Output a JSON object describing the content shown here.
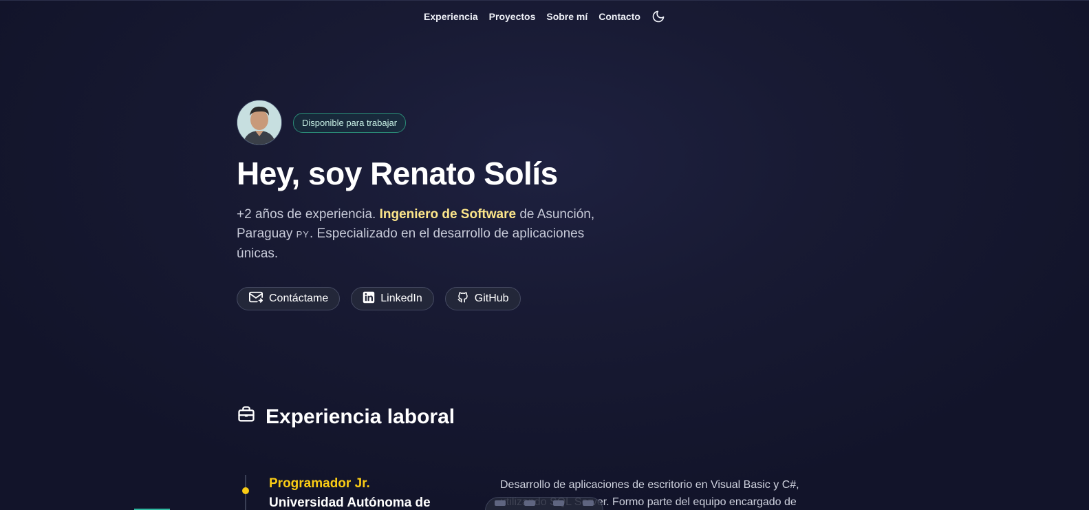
{
  "nav": {
    "items": [
      {
        "label": "Experiencia"
      },
      {
        "label": "Proyectos"
      },
      {
        "label": "Sobre mí"
      },
      {
        "label": "Contacto"
      }
    ],
    "theme_icon": "moon-icon"
  },
  "hero": {
    "avatar_alt": "avatar",
    "badge": "Disponible para trabajar",
    "title": "Hey, soy Renato Solís",
    "desc_prefix": "+2 años de experiencia. ",
    "desc_highlight": "Ingeniero de Software",
    "desc_mid": " de Asunción, Paraguay ",
    "desc_flag": "PY",
    "desc_suffix": ". Especializado en el desarrollo de aplicaciones únicas.",
    "buttons": [
      {
        "label": "Contáctame",
        "icon": "mail-icon"
      },
      {
        "label": "LinkedIn",
        "icon": "linkedin-icon"
      },
      {
        "label": "GitHub",
        "icon": "github-icon"
      }
    ]
  },
  "experience": {
    "heading": "Experiencia laboral",
    "heading_icon": "briefcase-icon",
    "jobs": [
      {
        "role": "Programador Jr.",
        "company": "Universidad Autónoma de",
        "description": "Desarrollo de aplicaciones de escritorio en Visual Basic y C#, utilizando SQL Server. Formo parte del equipo encargado de"
      }
    ]
  },
  "colors": {
    "highlight": "#fde68a",
    "role": "#facc15",
    "badge_border": "#2a8a76",
    "background": "#181a33"
  }
}
